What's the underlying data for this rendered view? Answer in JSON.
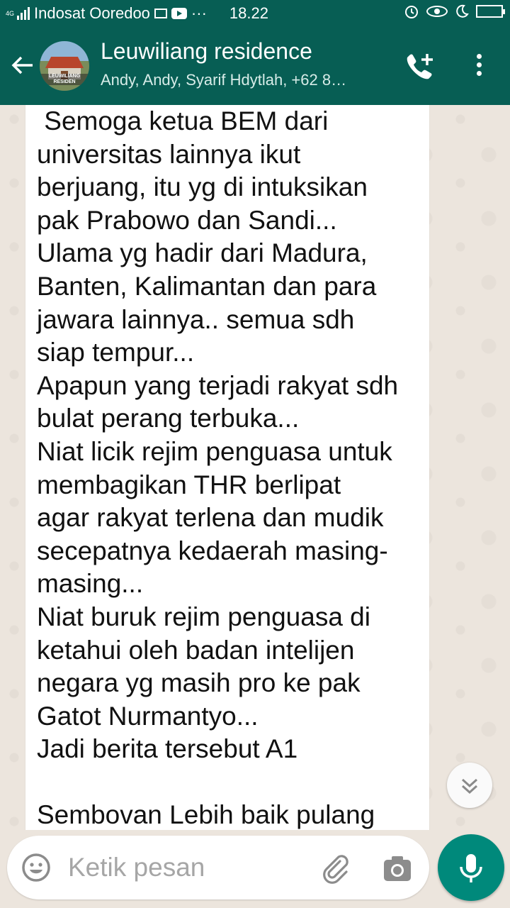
{
  "status_bar": {
    "network": "4G",
    "carrier": "Indosat Ooredoo",
    "overflow": "···",
    "time": "18.22",
    "icons": [
      "signal-icon",
      "gmail-icon",
      "youtube-icon",
      "alarm-icon",
      "eye-icon",
      "moon-icon",
      "battery-icon"
    ]
  },
  "header": {
    "avatar_text": "LEUWILIANG RESIDEN",
    "title": "Leuwiliang residence",
    "subtitle": "Andy, Andy, Syarif Hdytlah, +62 8…",
    "icons": [
      "back-arrow-icon",
      "add-call-icon",
      "more-vert-icon"
    ]
  },
  "message": {
    "text": " Semoga ketua BEM dari\nuniversitas lainnya ikut\nberjuang, itu yg di intuksikan\npak Prabowo dan Sandi...\nUlama yg hadir dari Madura,\nBanten, Kalimantan dan para\njawara lainnya.. semua sdh\nsiap tempur...\nApapun yang terjadi rakyat sdh\nbulat perang terbuka...\nNiat licik rejim penguasa untuk\nmembagikan THR berlipat\nagar rakyat terlena dan mudik\nsecepatnya kedaerah masing-\nmasing...\nNiat buruk rejim penguasa di\nketahui oleh badan intelijen\nnegara yg masih pro ke pak\nGatot Nurmantyo...\nJadi berita tersebut A1\n\nSembovan Lebih baik pulang"
  },
  "composer": {
    "placeholder": "Ketik pesan",
    "value": "",
    "icons": [
      "emoji-icon",
      "attach-icon",
      "camera-icon",
      "mic-icon",
      "chevron-down-double-icon"
    ]
  },
  "colors": {
    "primary": "#075e54",
    "accent": "#00897b",
    "chat_bg": "#ece5dd"
  }
}
